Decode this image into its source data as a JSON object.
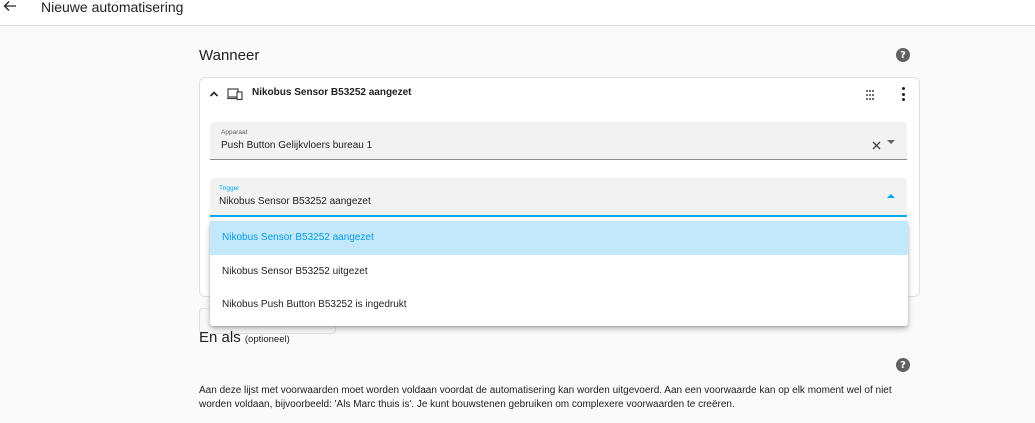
{
  "header": {
    "title": "Nieuwe automatisering",
    "back_icon": "arrow-left-icon"
  },
  "when_section": {
    "title": "Wanneer",
    "help_icon": "help-circle-icon",
    "trigger_card": {
      "title": "Nikobus Sensor B53252 aangezet",
      "collapse_icon": "chevron-up-icon",
      "device_icon": "devices-icon",
      "drag_icon": "drag-handle-icon",
      "menu_icon": "more-vertical-icon",
      "device_field": {
        "label": "Apparaat",
        "value": "Push Button Gelijkvloers bureau 1"
      },
      "trigger_field": {
        "label": "Trigger",
        "value": "Nikobus Sensor B53252 aangezet"
      }
    },
    "trigger_options": [
      {
        "label": "Nikobus Sensor B53252 aangezet",
        "selected": true
      },
      {
        "label": "Nikobus Sensor B53252 uitgezet",
        "selected": false
      },
      {
        "label": "Nikobus Push Button B53252 is ingedrukt",
        "selected": false
      }
    ]
  },
  "conditions_section": {
    "title": "En als",
    "optional": "(optioneel)",
    "help_icon": "help-circle-icon",
    "description": "Aan deze lijst met voorwaarden moet worden voldaan voordat de automatisering kan worden uitgevoerd. Aan een voorwaarde kan op elk moment wel of niet worden voldaan, bijvoorbeeld: 'Als Marc thuis is'. Je kunt bouwstenen gebruiken om complexere voorwaarden te creëren."
  },
  "colors": {
    "accent": "#03a9f4",
    "selected_bg": "#c3e8fb",
    "page_bg": "#fafafa"
  }
}
